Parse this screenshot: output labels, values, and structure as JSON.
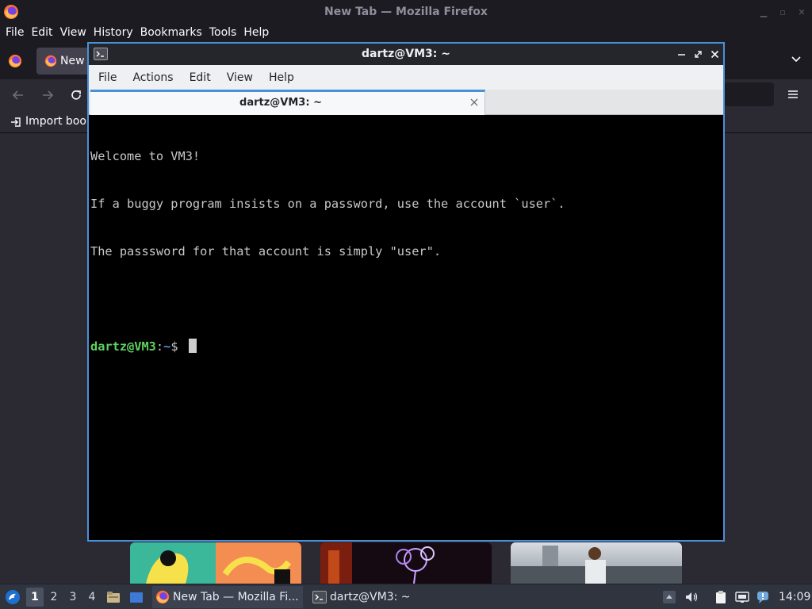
{
  "firefox": {
    "window_title": "New Tab — Mozilla Firefox",
    "menu": [
      "File",
      "Edit",
      "View",
      "History",
      "Bookmarks",
      "Tools",
      "Help"
    ],
    "tab_label": "New",
    "bookmarks_import_label": "Import book"
  },
  "terminal": {
    "window_title": "dartz@VM3: ~",
    "menu": [
      "File",
      "Actions",
      "Edit",
      "View",
      "Help"
    ],
    "tab_title": "dartz@VM3: ~",
    "lines": [
      "Welcome to VM3!",
      "If a buggy program insists on a password, use the account `user`.",
      "The passsword for that account is simply \"user\"."
    ],
    "prompt": {
      "user_host": "dartz@VM3",
      "separator": ":",
      "path": "~",
      "symbol": "$ "
    }
  },
  "taskbar": {
    "workspaces": [
      "1",
      "2",
      "3",
      "4"
    ],
    "active_workspace": "1",
    "tasks": [
      {
        "label": "New Tab — Mozilla Fi...",
        "icon": "firefox-icon"
      },
      {
        "label": "dartz@VM3: ~",
        "icon": "terminal-icon"
      }
    ],
    "clock": "14:09"
  },
  "colors": {
    "accent": "#4a90d9",
    "prompt_user": "#5ed35e",
    "prompt_path": "#5b8fe8"
  }
}
